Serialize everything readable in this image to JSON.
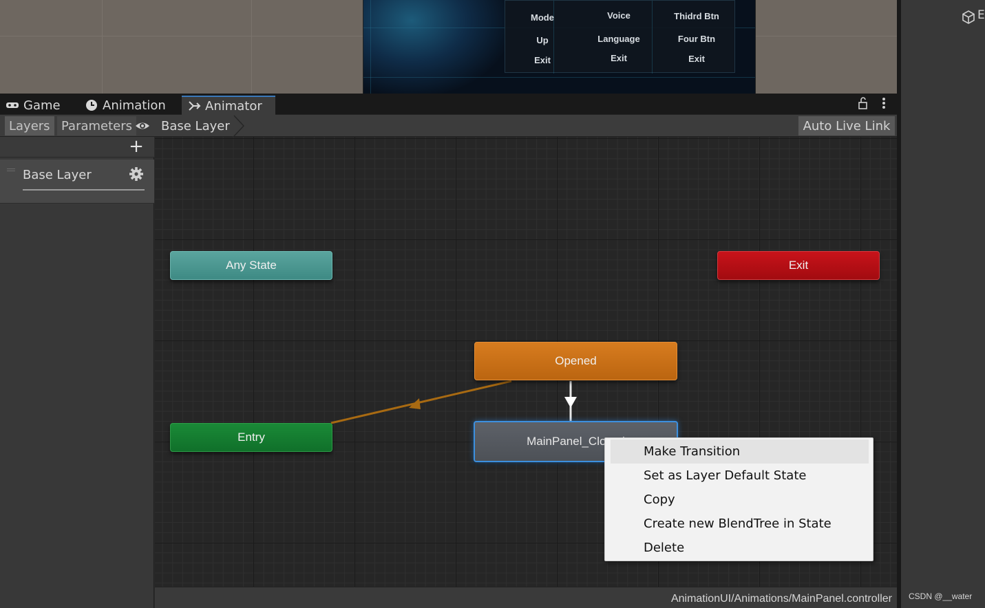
{
  "window_tabs": [
    {
      "label": "Game",
      "icon": "gamepad-icon",
      "active": false
    },
    {
      "label": "Animation",
      "icon": "clock-icon",
      "active": false
    },
    {
      "label": "Animator",
      "icon": "animator-icon",
      "active": true
    }
  ],
  "toolbar": {
    "layers_label": "Layers",
    "parameters_label": "Parameters",
    "breadcrumb": "Base Layer",
    "auto_live_link_label": "Auto Live Link"
  },
  "layers_panel": {
    "layers": [
      {
        "name": "Base Layer"
      }
    ]
  },
  "graph": {
    "nodes": {
      "any_state": "Any State",
      "exit": "Exit",
      "opened": "Opened",
      "entry": "Entry",
      "main_panel_closed": "MainPanel_Closed"
    },
    "node_colors": {
      "any_state": "#4b9a93",
      "exit": "#b30f15",
      "opened": "#c97016",
      "entry": "#167d30",
      "selected_outline": "#3c90e0"
    }
  },
  "context_menu": {
    "items": [
      {
        "label": "Make Transition",
        "highlighted": true
      },
      {
        "label": "Set as Layer Default State",
        "highlighted": false
      },
      {
        "label": "Copy",
        "highlighted": false
      },
      {
        "label": "Create new BlendTree in State",
        "highlighted": false
      },
      {
        "label": "Delete",
        "highlighted": false
      }
    ]
  },
  "footer": {
    "path": "AnimationUI/Animations/MainPanel.controller"
  },
  "game_preview": {
    "menu_col1": [
      "Mode",
      "Up",
      "Exit"
    ],
    "menu_col2": [
      "Voice",
      "Language",
      "Exit"
    ],
    "menu_col3": [
      "Thidrd Btn",
      "Four Btn",
      "Exit"
    ]
  },
  "side_panel": {
    "header_char": "E"
  },
  "watermark": "CSDN @__water"
}
